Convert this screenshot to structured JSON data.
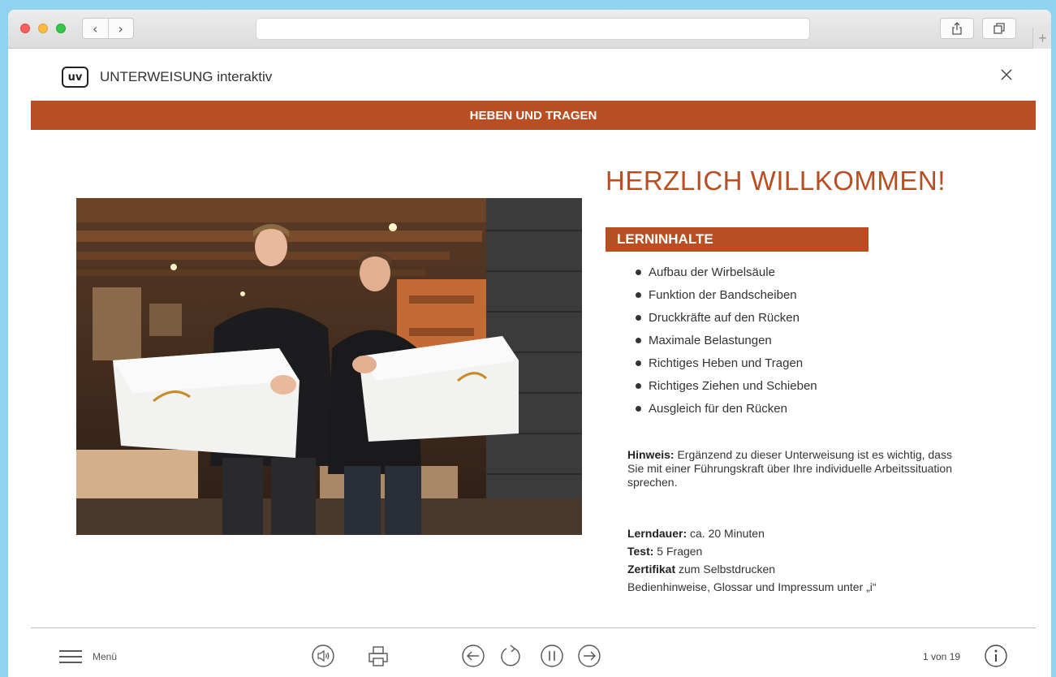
{
  "browser": {
    "back_glyph": "‹",
    "forward_glyph": "›",
    "new_tab_glyph": "+"
  },
  "header": {
    "logo_text": "uv",
    "app_title": "UNTERWEISUNG interaktiv"
  },
  "banner": {
    "title": "HEBEN UND TRAGEN"
  },
  "main": {
    "welcome": "HERZLICH WILLKOMMEN!",
    "section_title": "LERNINHALTE",
    "learn_items": [
      "Aufbau der Wirbelsäule",
      "Funktion der Bandscheiben",
      "Druckkräfte auf den Rücken",
      "Maximale Belastungen",
      "Richtiges Heben und Tragen",
      "Richtiges Ziehen und Schieben",
      "Ausgleich für den Rücken"
    ],
    "hint_label": "Hinweis:",
    "hint_text": " Ergänzend zu dieser Unterweisung ist es wichtig, dass Sie mit einer Führungskraft über Ihre individuelle Arbeitssituation sprechen.",
    "duration_label": "Lerndauer:",
    "duration_value": " ca. 20 Minuten",
    "test_label": "Test:",
    "test_value": " 5 Fragen",
    "cert_label": "Zertifikat",
    "cert_value": " zum Selbstdrucken",
    "info_line": "Bedienhinweise, Glossar und Impressum unter „i“"
  },
  "footer": {
    "menu_label": "Menü",
    "page_indicator": "1 von 19"
  },
  "icons": {
    "share": "share-icon",
    "tabs": "tabs-icon",
    "close": "close-icon",
    "menu": "hamburger-icon",
    "sound": "speaker-icon",
    "print": "printer-icon",
    "prev": "arrow-left-icon",
    "reload": "reload-icon",
    "pause": "pause-icon",
    "next": "arrow-right-icon",
    "info": "info-icon"
  },
  "colors": {
    "accent": "#b84e21",
    "background": "#8fd3f0",
    "text": "#333333"
  }
}
